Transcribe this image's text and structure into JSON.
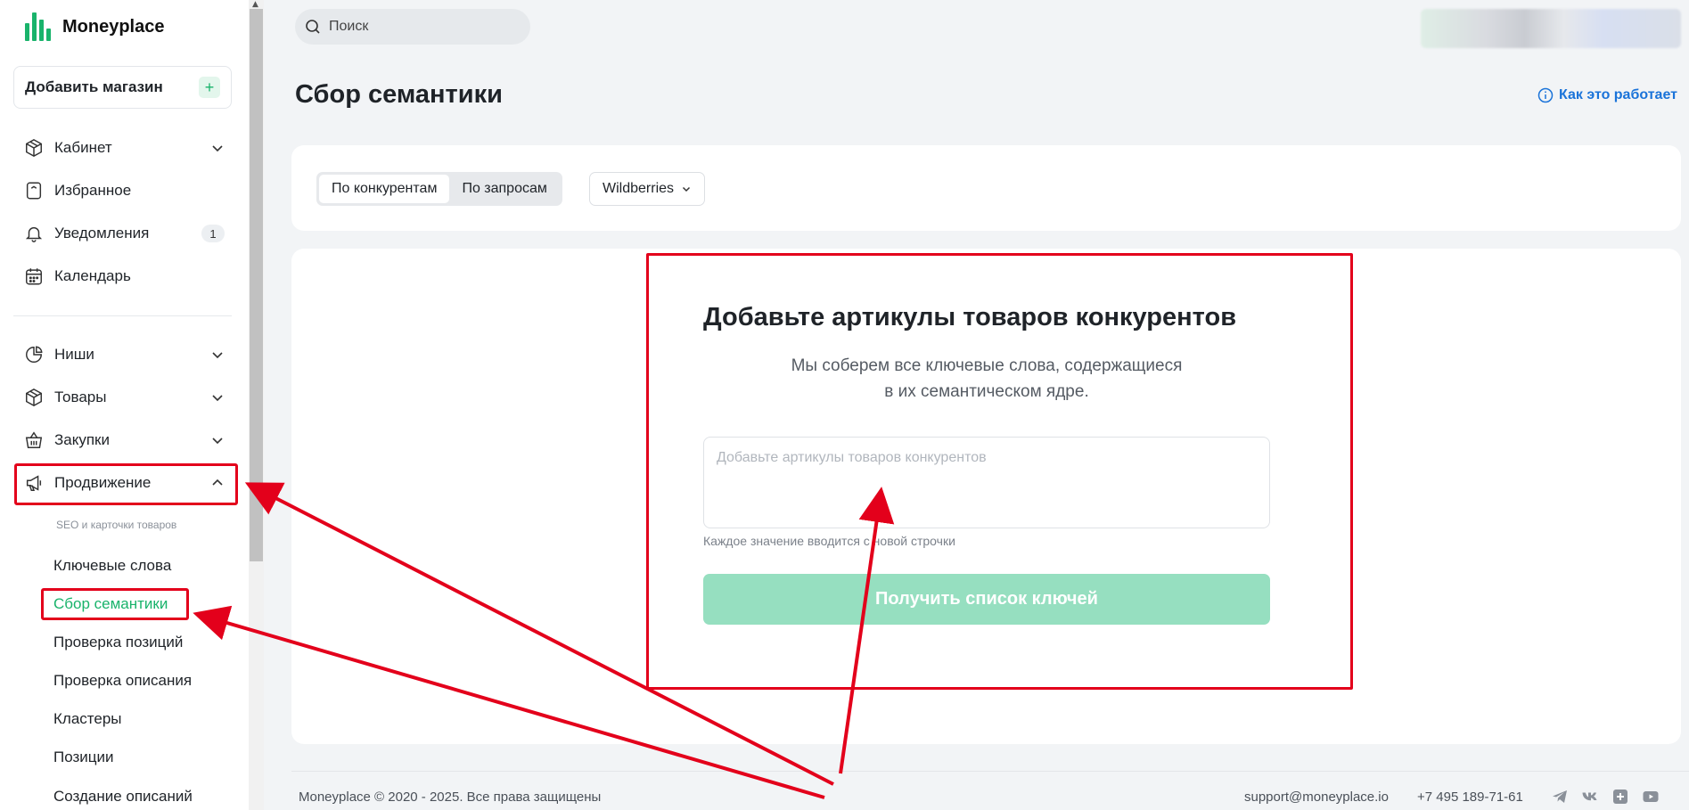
{
  "app": {
    "brand": "Moneyplace",
    "accent_color": "#19b36b",
    "link_color": "#1a73d9",
    "annotation_color": "#e3001b"
  },
  "sidebar": {
    "add_store": {
      "label": "Добавить магазин",
      "icon": "plus-icon"
    },
    "items": [
      {
        "label": "Кабинет",
        "icon": "box-icon",
        "expandable": true
      },
      {
        "label": "Избранное",
        "icon": "bookmark-icon"
      },
      {
        "label": "Уведомления",
        "icon": "bell-icon",
        "badge": "1"
      },
      {
        "label": "Календарь",
        "icon": "calendar-icon"
      },
      {
        "label": "Ниши",
        "icon": "pie-chart-icon",
        "expandable": true
      },
      {
        "label": "Товары",
        "icon": "box-icon",
        "expandable": true
      },
      {
        "label": "Закупки",
        "icon": "basket-icon",
        "expandable": true
      },
      {
        "label": "Продвижение",
        "icon": "megaphone-icon",
        "expandable": true,
        "expanded": true
      }
    ],
    "promo_caption": "SEO и карточки товаров",
    "promo_items": [
      {
        "label": "Ключевые слова"
      },
      {
        "label": "Сбор семантики",
        "active": true
      },
      {
        "label": "Проверка позиций"
      },
      {
        "label": "Проверка описания"
      },
      {
        "label": "Кластеры"
      },
      {
        "label": "Позиции"
      },
      {
        "label": "Создание описаний"
      }
    ]
  },
  "header": {
    "search_placeholder": "Поиск",
    "page_title": "Сбор семантики",
    "how_it_works": "Как это работает"
  },
  "filters": {
    "modes": [
      {
        "label": "По конкурентам",
        "active": true
      },
      {
        "label": "По запросам",
        "active": false
      }
    ],
    "marketplace": "Wildberries"
  },
  "form": {
    "title": "Добавьте артикулы товаров конкурентов",
    "subtitle_line1": "Мы соберем все ключевые слова, содержащиеся",
    "subtitle_line2": "в их семантическом ядре.",
    "input_placeholder": "Добавьте артикулы товаров конкурентов",
    "hint": "Каждое значение вводится с новой строчки",
    "submit_label": "Получить список ключей"
  },
  "footer": {
    "copyright": "Moneyplace © 2020 - 2025. Все права защищены",
    "email": "support@moneyplace.io",
    "phone": "+7 495 189-71-61",
    "social_icons": [
      "telegram-icon",
      "vk-icon",
      "plus-square-icon",
      "youtube-icon"
    ]
  }
}
